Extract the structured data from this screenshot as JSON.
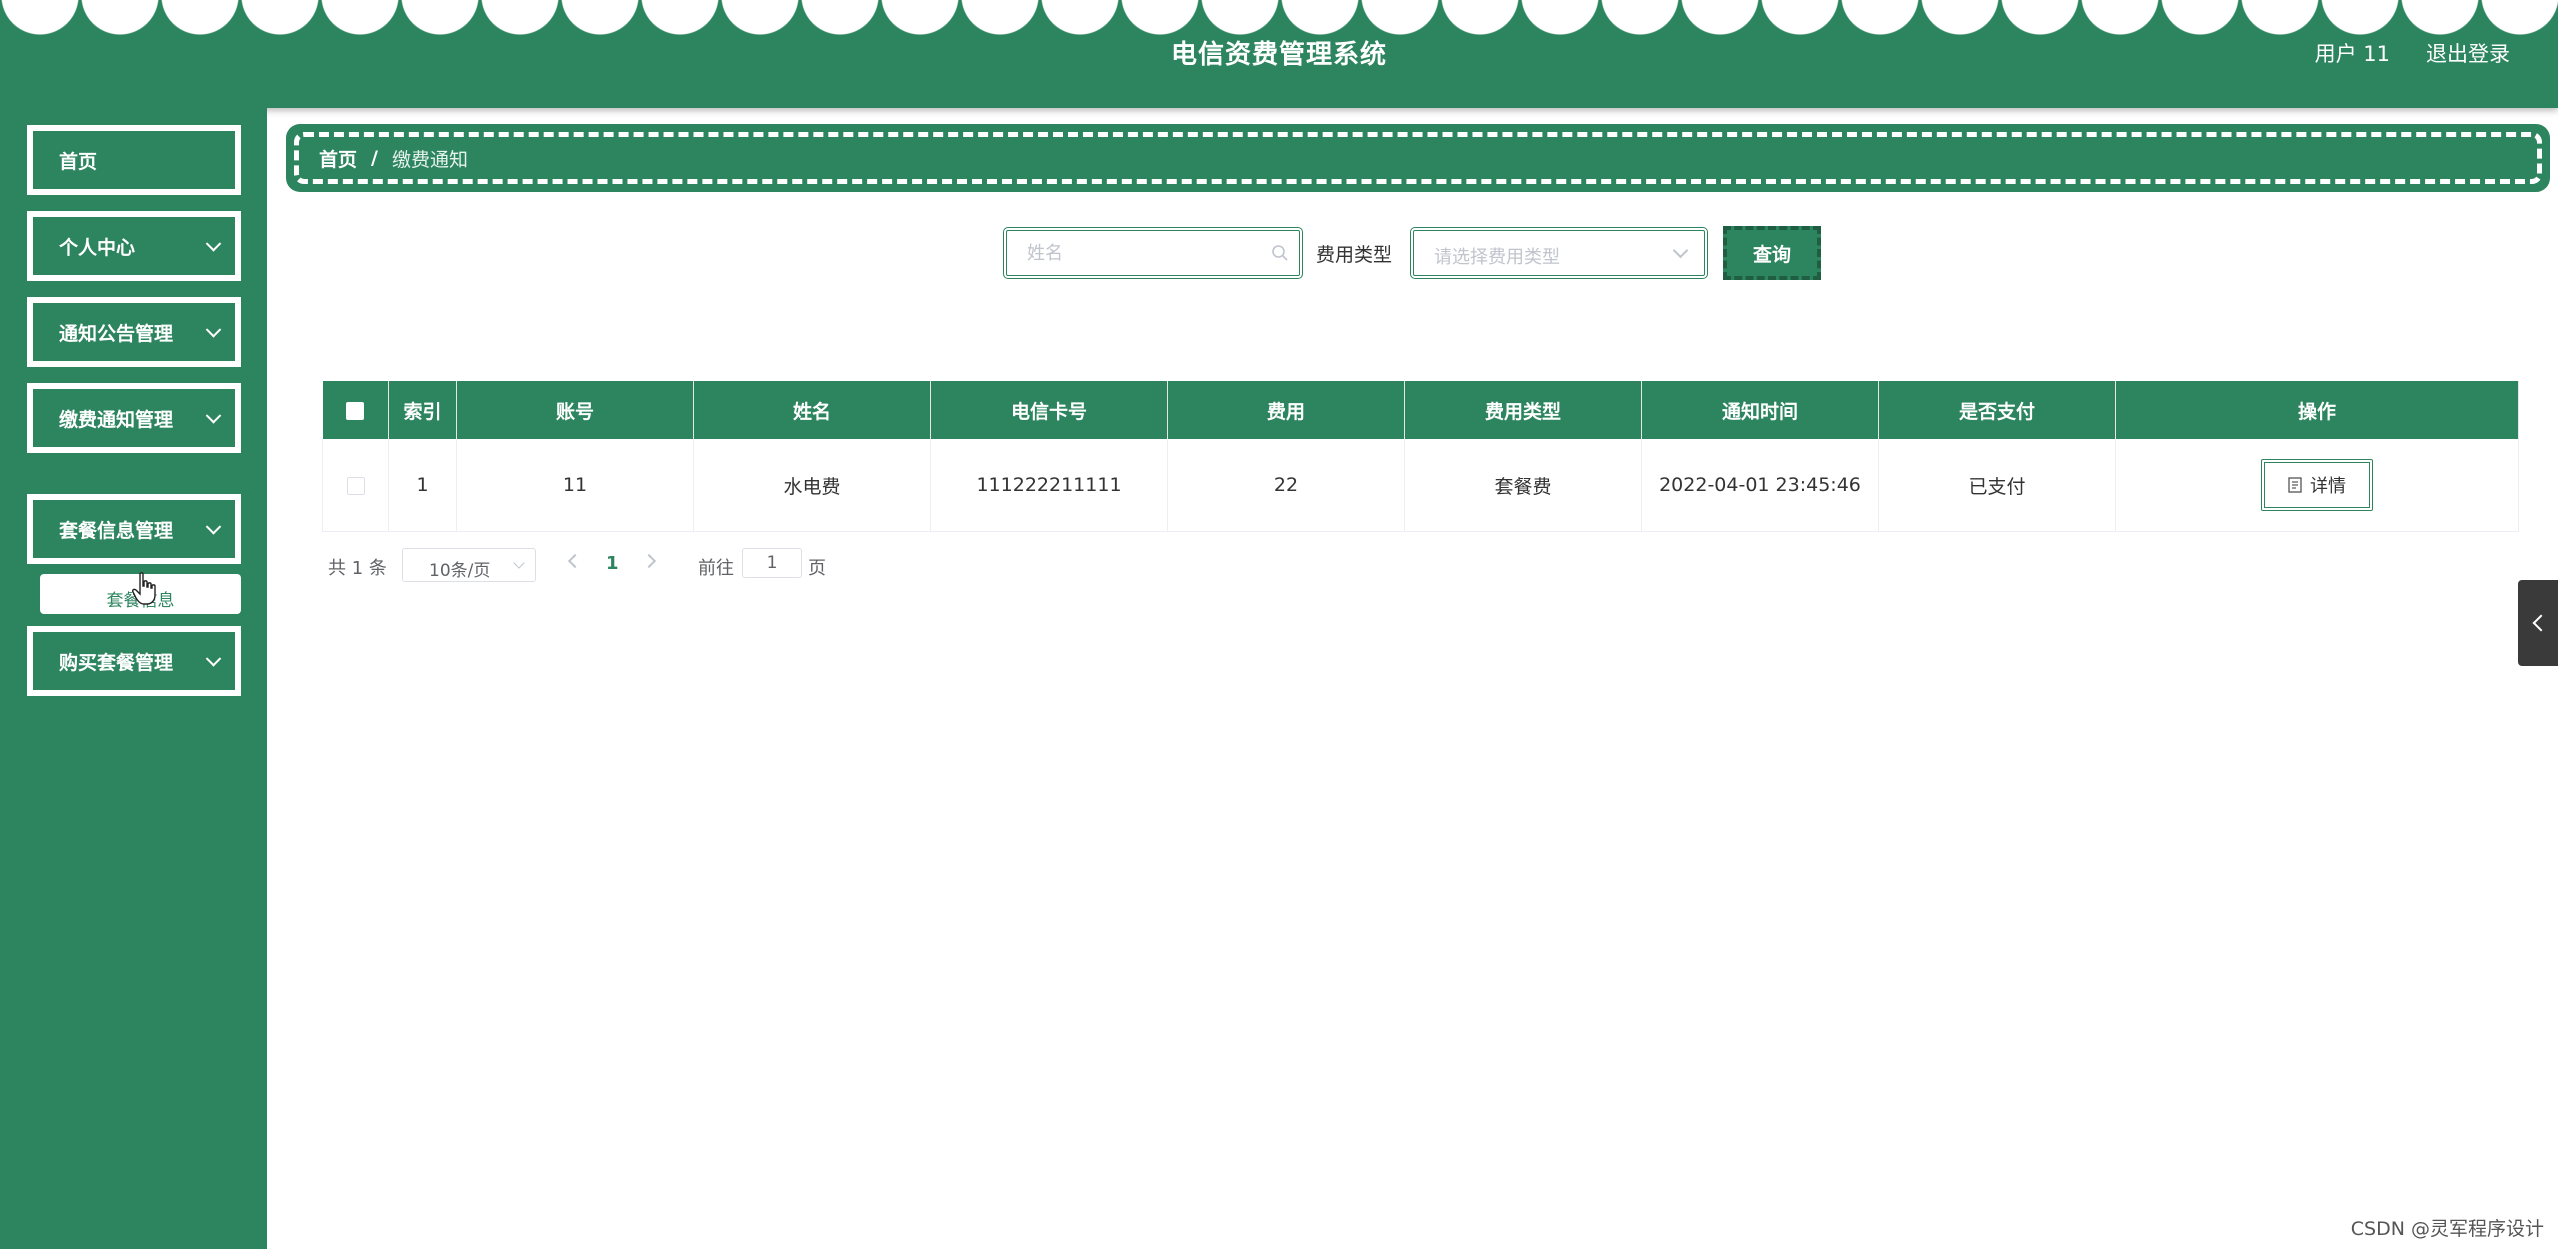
{
  "header": {
    "title": "电信资费管理系统",
    "user_label": "用户 11",
    "logout_label": "退出登录"
  },
  "sidebar": {
    "items": [
      {
        "label": "首页"
      },
      {
        "label": "个人中心"
      },
      {
        "label": "通知公告管理"
      },
      {
        "label": "缴费通知管理"
      },
      {
        "label": "套餐信息管理"
      },
      {
        "label": "购买套餐管理"
      }
    ],
    "submenu_label": "套餐信息"
  },
  "breadcrumb": {
    "home": "首页",
    "separator": "/",
    "current": "缴费通知"
  },
  "search": {
    "name_placeholder": "姓名",
    "type_label": "费用类型",
    "type_placeholder": "请选择费用类型",
    "query_label": "查询"
  },
  "table": {
    "columns": [
      "索引",
      "账号",
      "姓名",
      "电信卡号",
      "费用",
      "费用类型",
      "通知时间",
      "是否支付",
      "操作"
    ],
    "rows": [
      {
        "index": "1",
        "account": "11",
        "name": "水电费",
        "card": "111222211111",
        "fee": "22",
        "fee_type": "套餐费",
        "time": "2022-04-01 23:45:46",
        "paid": "已支付",
        "action": "详情"
      }
    ]
  },
  "pagination": {
    "total": "共 1 条",
    "page_size": "10条/页",
    "current_page": "1",
    "goto_label": "前往",
    "goto_value": "1",
    "page_label": "页"
  },
  "watermark": "CSDN @灵军程序设计",
  "colors": {
    "primary": "#2d8560",
    "sidebar_bg": "#2d8560",
    "header_bg": "#2d8560"
  }
}
